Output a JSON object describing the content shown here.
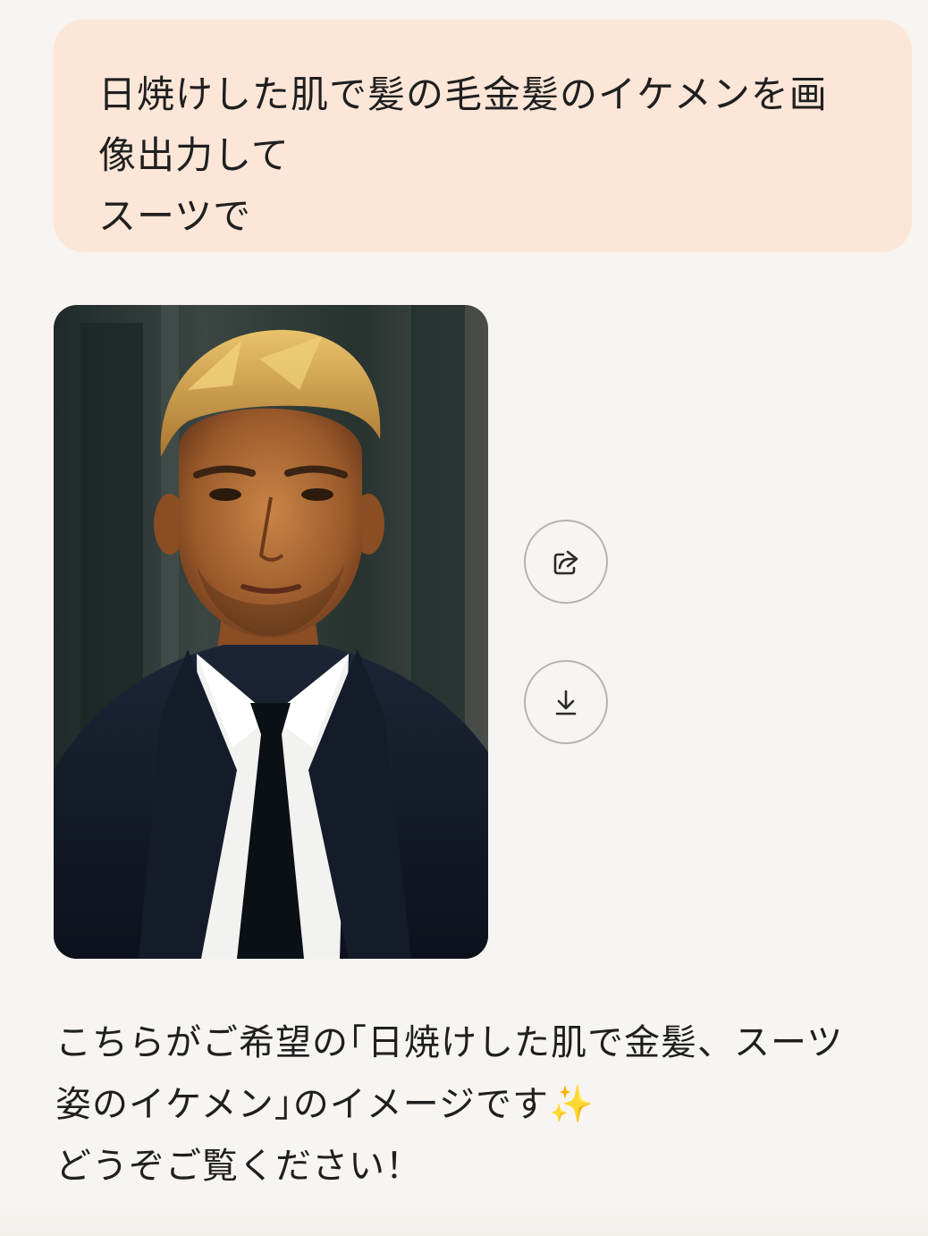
{
  "user_message": {
    "lines": [
      "日焼けした肌で髪の毛金髪のイケメンを画",
      "像出力して",
      "スーツで"
    ]
  },
  "generated_image": {
    "subject": "portrait of a tanned blond man in a navy suit and dark tie"
  },
  "actions": {
    "share_icon": "share-icon",
    "download_icon": "download-icon"
  },
  "assistant_reply": {
    "line1": "こちらがご希望の｢日焼けした肌で金髪、スーツ",
    "line2_text": "姿のイケメン｣のイメージです",
    "line2_emoji": "✨",
    "line3": "どうぞご覧ください！"
  },
  "colors": {
    "background": "#f7f4f1",
    "user_bubble": "#fce6d8",
    "button_border": "#b7b3b0",
    "text": "#1f1f1f"
  }
}
